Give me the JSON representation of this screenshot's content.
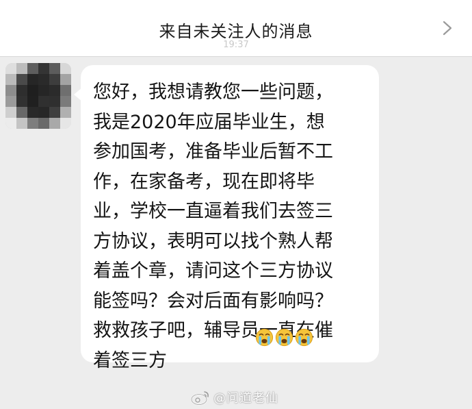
{
  "header": {
    "title": "来自未关注人的消息",
    "time": "19:37",
    "chevron_icon": "chevron-right-icon"
  },
  "conversation": {
    "sender_avatar": "blurred-avatar",
    "message": {
      "text": "您好，我想请教您一些问题，\n我是2020年应届毕业生，想\n参加国考，准备毕业后暂不工\n作，在家备考，现在即将毕\n业，学校一直逼着我们去签三\n方协议，表明可以找个熟人帮\n着盖个章，请问这个三方协议\n能签吗？会对后面有影响吗？\n救救孩子吧，辅导员一直在催\n着签三方",
      "emojis": [
        "crying-face-emoji",
        "crying-face-emoji",
        "crying-face-emoji"
      ]
    }
  },
  "watermark": {
    "logo": "weibo-logo",
    "text": "@问道老仙"
  },
  "colors": {
    "background": "#ededed",
    "bubble": "#ffffff",
    "text": "#151515",
    "header": "#ffffff"
  }
}
